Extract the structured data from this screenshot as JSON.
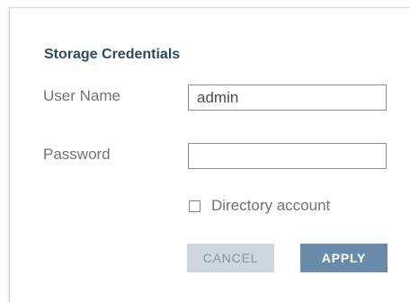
{
  "dialog": {
    "title": "Storage Credentials",
    "username_label": "User Name",
    "username_value": "admin",
    "password_label": "Password",
    "password_value": "",
    "directory_checkbox_label": "Directory account",
    "directory_checkbox_checked": false,
    "cancel_label": "CANCEL",
    "apply_label": "APPLY"
  }
}
